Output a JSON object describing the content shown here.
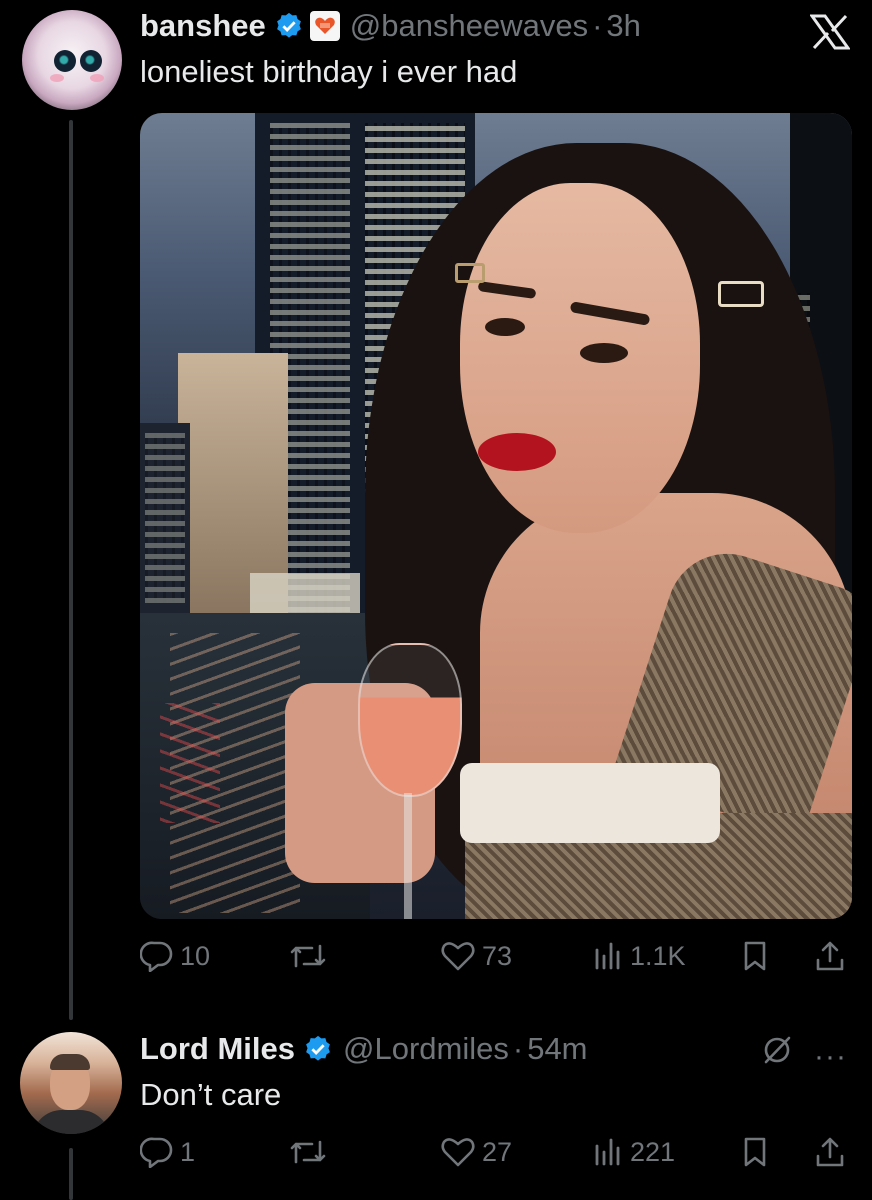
{
  "tweet": {
    "display_name": "banshee",
    "handle": "@bansheewaves",
    "separator": "·",
    "time": "3h",
    "text": "loneliest birthday i ever had",
    "image": {
      "alt": "selfie holding a glass of rosé in front of a night city window"
    },
    "stats": {
      "replies": "10",
      "retweets": "",
      "likes": "73",
      "views": "1.1K"
    }
  },
  "reply": {
    "display_name": "Lord Miles",
    "handle": "@Lordmiles",
    "separator": "·",
    "time": "54m",
    "text": "Don’t care",
    "more_label": "···",
    "stats": {
      "replies": "1",
      "retweets": "",
      "likes": "27",
      "views": "221"
    }
  },
  "icons": {
    "verified": "verified-badge-icon",
    "org": "heart-org-badge-icon",
    "x_logo": "x-logo-icon",
    "reply": "reply-icon",
    "retweet": "retweet-icon",
    "like": "heart-icon",
    "views": "views-chart-icon",
    "bookmark": "bookmark-icon",
    "share": "share-icon",
    "mute": "mute-icon"
  },
  "colors": {
    "background": "#000000",
    "text": "#e7e9ea",
    "muted": "#71767b",
    "verified": "#1d9bf0",
    "thread_line": "#333639"
  }
}
